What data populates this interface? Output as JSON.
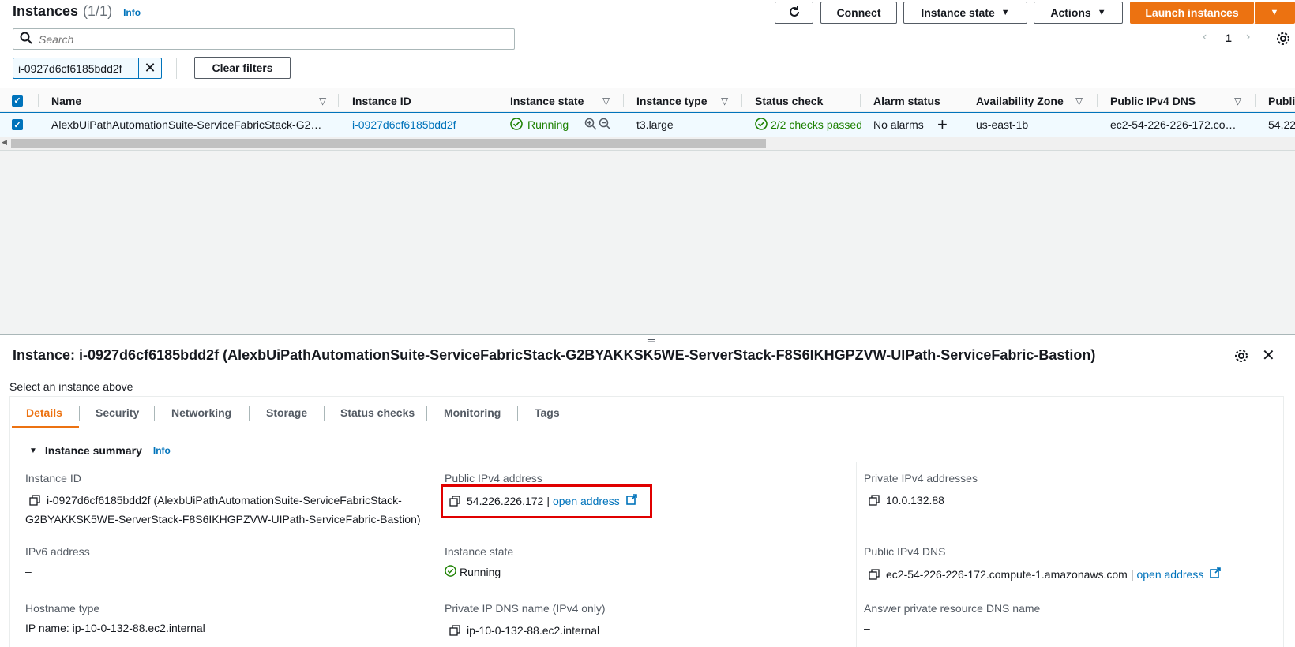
{
  "header": {
    "title": "Instances",
    "count": "(1/1)",
    "info": "Info",
    "connect_label": "Connect",
    "instance_state_label": "Instance state",
    "actions_label": "Actions",
    "launch_label": "Launch instances",
    "page_number": "1"
  },
  "search": {
    "placeholder": "Search"
  },
  "filter": {
    "token": "i-0927d6cf6185bdd2f",
    "clear_label": "Clear filters"
  },
  "table": {
    "columns": [
      "Name",
      "Instance ID",
      "Instance state",
      "Instance type",
      "Status check",
      "Alarm status",
      "Availability Zone",
      "Public IPv4 DNS",
      "Publi"
    ],
    "row": {
      "name": "AlexbUiPathAutomationSuite-ServiceFabricStack-G2…",
      "instance_id": "i-0927d6cf6185bdd2f",
      "state": "Running",
      "type": "t3.large",
      "status_check": "2/2 checks passed",
      "alarm_status": "No alarms",
      "az": "us-east-1b",
      "dns": "ec2-54-226-226-172.co…",
      "public_ip_partial": "54.22"
    }
  },
  "panel": {
    "title": "Instance: i-0927d6cf6185bdd2f (AlexbUiPathAutomationSuite-ServiceFabricStack-G2BYAKKSK5WE-ServerStack-F8S6IKHGPZVW-UIPath-ServiceFabric-Bastion)",
    "select_above": "Select an instance above",
    "tabs": [
      "Details",
      "Security",
      "Networking",
      "Storage",
      "Status checks",
      "Monitoring",
      "Tags"
    ],
    "summary_title": "Instance summary",
    "summary_info": "Info",
    "fields": {
      "instance_id_label": "Instance ID",
      "instance_id_line1": "i-0927d6cf6185bdd2f (AlexbUiPathAutomationSuite-ServiceFabricStack-",
      "instance_id_line2": "G2BYAKKSK5WE-ServerStack-F8S6IKHGPZVW-UIPath-ServiceFabric-Bastion)",
      "public_ipv4_label": "Public IPv4 address",
      "public_ipv4": "54.226.226.172",
      "open_address": "open address",
      "private_ipv4_label": "Private IPv4 addresses",
      "private_ipv4": "10.0.132.88",
      "ipv6_label": "IPv6 address",
      "ipv6": "–",
      "instance_state_label": "Instance state",
      "instance_state": "Running",
      "public_dns_label": "Public IPv4 DNS",
      "public_dns": "ec2-54-226-226-172.compute-1.amazonaws.com",
      "hostname_type_label": "Hostname type",
      "hostname_type": "IP name: ip-10-0-132-88.ec2.internal",
      "private_dns_label": "Private IP DNS name (IPv4 only)",
      "private_dns": "ip-10-0-132-88.ec2.internal",
      "answer_dns_label": "Answer private resource DNS name",
      "answer_dns": "–"
    }
  },
  "colors": {
    "accent": "#ec7211",
    "link": "#0073bb",
    "success": "#1d8102",
    "highlight": "#e00000"
  }
}
